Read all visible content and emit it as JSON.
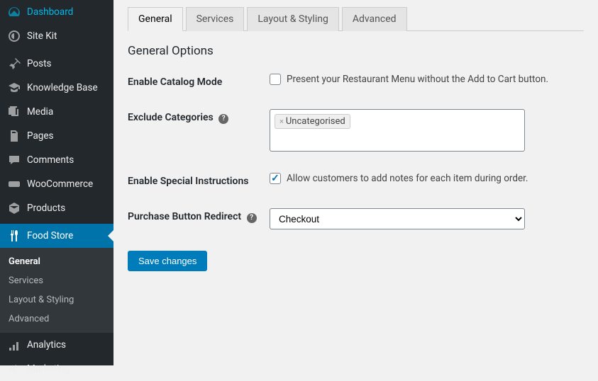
{
  "sidebar": {
    "menus": [
      {
        "label": "Dashboard",
        "icon": "dashboard"
      },
      {
        "label": "Site Kit",
        "icon": "sitekit"
      },
      {
        "label": "Posts",
        "icon": "pin"
      },
      {
        "label": "Knowledge Base",
        "icon": "cap"
      },
      {
        "label": "Media",
        "icon": "media"
      },
      {
        "label": "Pages",
        "icon": "pages"
      },
      {
        "label": "Comments",
        "icon": "comments"
      },
      {
        "label": "WooCommerce",
        "icon": "woo"
      },
      {
        "label": "Products",
        "icon": "products"
      },
      {
        "label": "Food Store",
        "icon": "food",
        "active": true
      },
      {
        "label": "Analytics",
        "icon": "analytics"
      },
      {
        "label": "Marketing",
        "icon": "marketing"
      }
    ],
    "submenu": [
      {
        "label": "General",
        "current": true
      },
      {
        "label": "Services"
      },
      {
        "label": "Layout & Styling"
      },
      {
        "label": "Advanced"
      }
    ]
  },
  "tabs": [
    {
      "label": "General",
      "active": true
    },
    {
      "label": "Services"
    },
    {
      "label": "Layout & Styling"
    },
    {
      "label": "Advanced"
    }
  ],
  "heading": "General Options",
  "fields": {
    "catalog": {
      "label": "Enable Catalog Mode",
      "desc": "Present your Restaurant Menu without the Add to Cart button.",
      "checked": false
    },
    "exclude": {
      "label": "Exclude Categories",
      "tags": [
        "Uncategorised"
      ]
    },
    "special": {
      "label": "Enable Special Instructions",
      "desc": "Allow customers to add notes for each item during order.",
      "checked": true
    },
    "redirect": {
      "label": "Purchase Button Redirect",
      "value": "Checkout"
    }
  },
  "save_label": "Save changes"
}
